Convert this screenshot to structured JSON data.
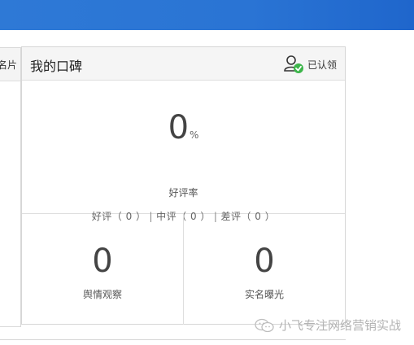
{
  "left_panel": {
    "tab_label": "名片"
  },
  "card": {
    "title": "我的口碑",
    "verify_label": "已认领",
    "score": {
      "value": "0",
      "unit": "%",
      "label": "好评率"
    },
    "ratings": [
      {
        "name": "好评",
        "count": "0"
      },
      {
        "name": "中评",
        "count": "0"
      },
      {
        "name": "差评",
        "count": "0"
      }
    ],
    "metrics": [
      {
        "value": "0",
        "label": "舆情观察"
      },
      {
        "value": "0",
        "label": "实名曝光"
      }
    ]
  },
  "watermark": {
    "text": "小飞专注网络营销实战"
  },
  "colors": {
    "topbar": "#2a74d4",
    "verify_check": "#3cb54a",
    "border": "#d6d6d6",
    "header_bg": "#f5f5f5"
  }
}
